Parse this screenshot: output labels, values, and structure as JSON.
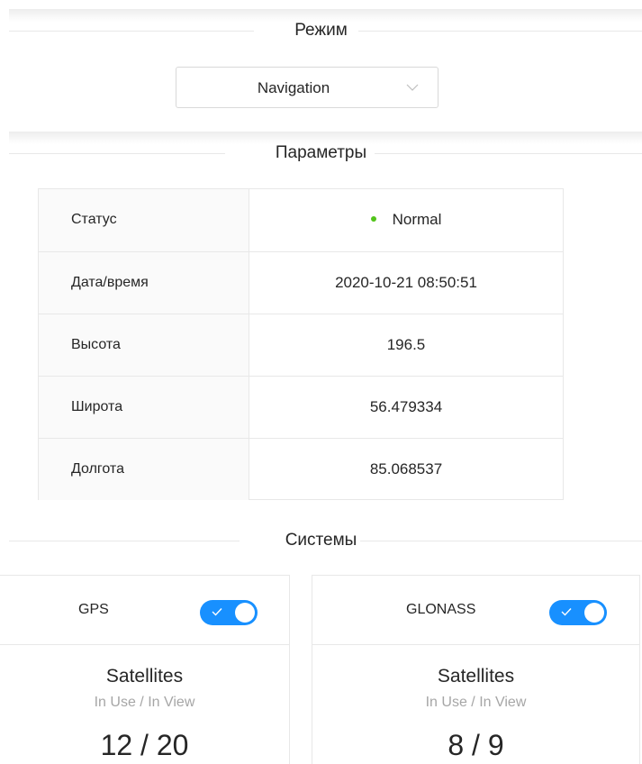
{
  "mode": {
    "section_title": "Режим",
    "selected": "Navigation"
  },
  "params": {
    "section_title": "Параметры",
    "rows": [
      {
        "label": "Статус",
        "value": "Normal"
      },
      {
        "label": "Дата/время",
        "value": "2020-10-21 08:50:51"
      },
      {
        "label": "Высота",
        "value": "196.5"
      },
      {
        "label": "Широта",
        "value": "56.479334"
      },
      {
        "label": "Долгота",
        "value": "85.068537"
      }
    ],
    "status_color": "#52c41a"
  },
  "systems": {
    "section_title": "Системы",
    "cards": [
      {
        "name": "GPS",
        "enabled": true,
        "title": "Satellites",
        "subtitle": "In Use / In View",
        "count": "12 / 20"
      },
      {
        "name": "GLONASS",
        "enabled": true,
        "title": "Satellites",
        "subtitle": "In Use / In View",
        "count": "8 / 9"
      }
    ]
  },
  "colors": {
    "accent": "#1890ff",
    "border": "#e8e8e8"
  }
}
